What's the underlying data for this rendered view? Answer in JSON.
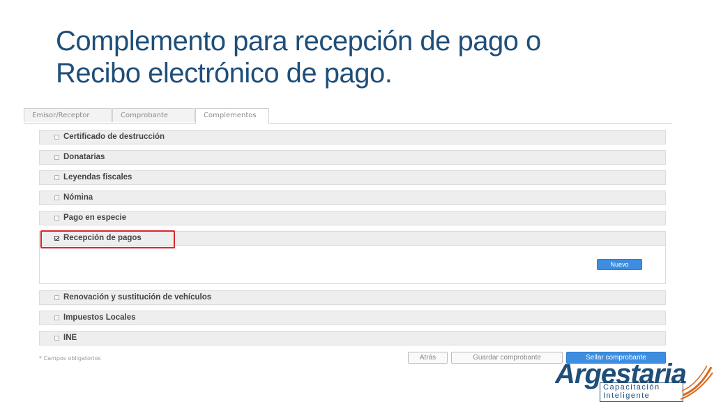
{
  "slide": {
    "title_line1": "Complemento para recepción de pago o",
    "title_line2": "Recibo electrónico de pago."
  },
  "tabs": [
    {
      "label": "Emisor/Receptor",
      "active": false
    },
    {
      "label": "Comprobante",
      "active": false
    },
    {
      "label": "Complementos",
      "active": true
    }
  ],
  "complements": [
    {
      "label": "Certificado de destrucción",
      "checked": false
    },
    {
      "label": "Donatarias",
      "checked": false
    },
    {
      "label": "Leyendas fiscales",
      "checked": false
    },
    {
      "label": "Nómina",
      "checked": false
    },
    {
      "label": "Pago en especie",
      "checked": false
    },
    {
      "label": "Recepción de pagos",
      "checked": true,
      "expanded": true
    },
    {
      "label": "Renovación y sustitución de vehículos",
      "checked": false
    },
    {
      "label": "Impuestos Locales",
      "checked": false
    },
    {
      "label": "INE",
      "checked": false
    }
  ],
  "panel": {
    "new_button": "Nuevo"
  },
  "footer": {
    "required_note": "* Campos obligatorios",
    "back_button": "Atrás",
    "save_button": "Guardar comprobante",
    "seal_button": "Sellar comprobante"
  },
  "logo": {
    "mark": "Argestaria",
    "tagline_line1": "Capacitación",
    "tagline_line2": "Inteligente"
  },
  "colors": {
    "title": "#1f4e79",
    "primary_button": "#3d8de0",
    "highlight": "#d9262e",
    "logo_accent": "#d9691f"
  }
}
